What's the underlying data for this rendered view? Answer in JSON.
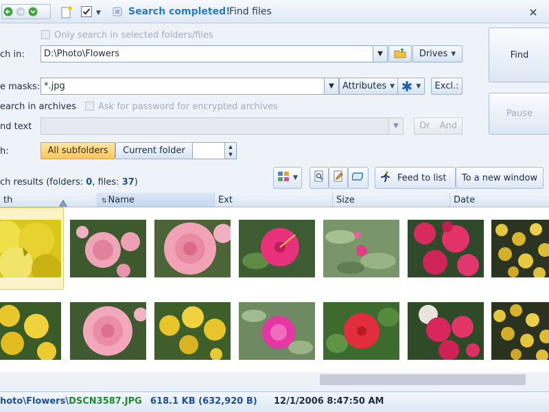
{
  "window": {
    "title": "Search completed!",
    "subtitle": "Find files"
  },
  "form": {
    "only_selected_label": "Only search in selected folders/files",
    "search_in_label": "ch in:",
    "search_in_value": "D:\\Photo\\Flowers",
    "drives_label": "Drives",
    "masks_label": "e masks:",
    "masks_value": "*.jpg",
    "attributes_label": "Attributes",
    "excl_label": "Excl.:",
    "archives_label": "earch in archives",
    "ask_password_label": "Ask for password for encrypted archives",
    "find_text_label": "nd text",
    "find_text_value": "",
    "or_label": "Or",
    "and_label": "And",
    "depth_label": "h:",
    "depth_all_label": "All subfolders",
    "depth_current_label": "Current folder",
    "depth_value": "",
    "find_button": "Find",
    "pause_button": "Pause"
  },
  "results": {
    "prefix": "ch results (folders: ",
    "folders": "0",
    "files_sep": ", files: ",
    "files": "37",
    "suffix": ")"
  },
  "toolbar": {
    "feed_label": "Feed to list",
    "new_window_label": "To a new window"
  },
  "columns": [
    "th",
    "Name",
    "Ext",
    "Size",
    "Date"
  ],
  "status": {
    "path": "hoto\\Flowers\\",
    "filename": "DSCN3587.JPG",
    "size": "618.1 KB (632,920 B)",
    "datetime": "12/1/2006 8:47:50 AM"
  },
  "colors": {
    "accent": "#2a78c8",
    "filename_green": "#1d8a2a",
    "status_blue": "#1d4f9a"
  },
  "thumbnails": [
    {
      "kind": "yellow-macro",
      "selected": true
    },
    {
      "kind": "pink-rose"
    },
    {
      "kind": "pink-rose-large"
    },
    {
      "kind": "magenta-hibiscus"
    },
    {
      "kind": "pink-small-leaves"
    },
    {
      "kind": "magenta-bougainvillea"
    },
    {
      "kind": "yellow-cluster"
    },
    {
      "kind": "yellow-cluster-2"
    },
    {
      "kind": "pink-carnation"
    },
    {
      "kind": "yellow-flowers"
    },
    {
      "kind": "magenta-rose"
    },
    {
      "kind": "red-hibiscus"
    },
    {
      "kind": "magenta-bougainvillea-2"
    },
    {
      "kind": "yellow-cluster-3"
    }
  ]
}
